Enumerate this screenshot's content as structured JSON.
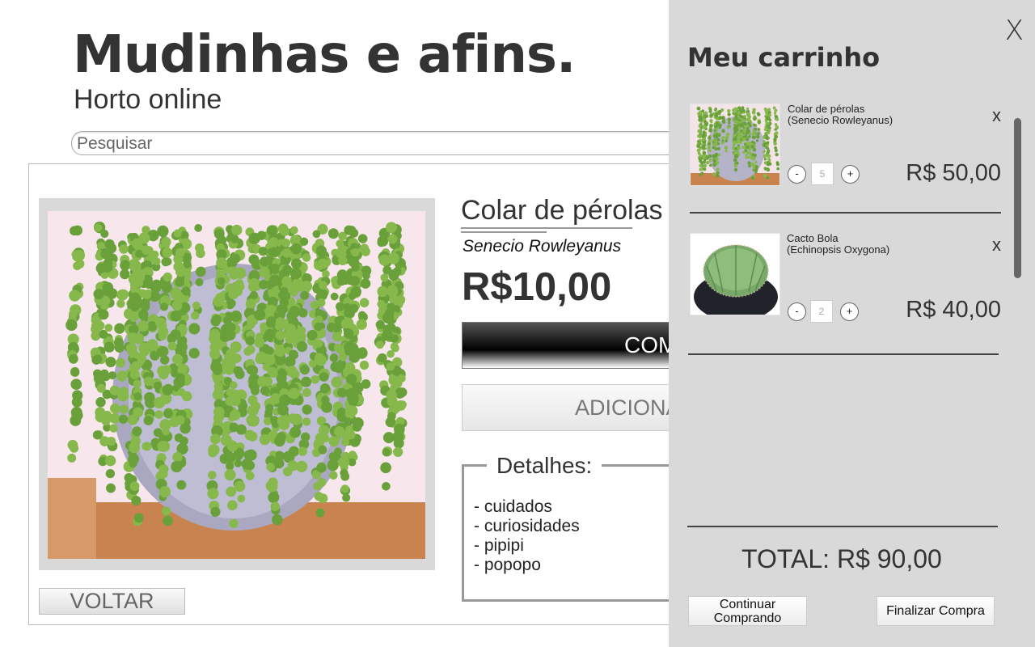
{
  "header": {
    "brand": "Mudinhas e afins.",
    "subtitle": "Horto online",
    "search_placeholder": "Pesquisar"
  },
  "product": {
    "name": "Colar de pérolas",
    "scientific_name": "Senecio Rowleyanus",
    "price": "R$10,00",
    "buy_label": "COMPRAR",
    "add_label": "ADICIONAR",
    "back_label": "VOLTAR",
    "details_title": "Detalhes:",
    "details": [
      "- cuidados",
      "- curiosidades",
      "- pipipi",
      "- popopo"
    ]
  },
  "cart": {
    "title": "Meu carrinho",
    "close_label": "X",
    "items": [
      {
        "name": "Colar de pérolas",
        "scientific": "(Senecio Rowleyanus)",
        "quantity": "5",
        "price": "R$ 50,00",
        "remove": "x",
        "minus": "-",
        "plus": "+"
      },
      {
        "name": "Cacto Bola",
        "scientific": "(Echinopsis Oxygona)",
        "quantity": "2",
        "price": "R$ 40,00",
        "remove": "x",
        "minus": "-",
        "plus": "+"
      }
    ],
    "total": "TOTAL: R$ 90,00",
    "continue_line1": "Continuar",
    "continue_line2": "Comprando",
    "checkout_label": "Finalizar Compra"
  },
  "colors": {
    "panel_bg": "#d9d9d9",
    "text_dark": "#333333",
    "plant_green": "#6aa03a",
    "pot_gray": "#a9a8c0"
  }
}
